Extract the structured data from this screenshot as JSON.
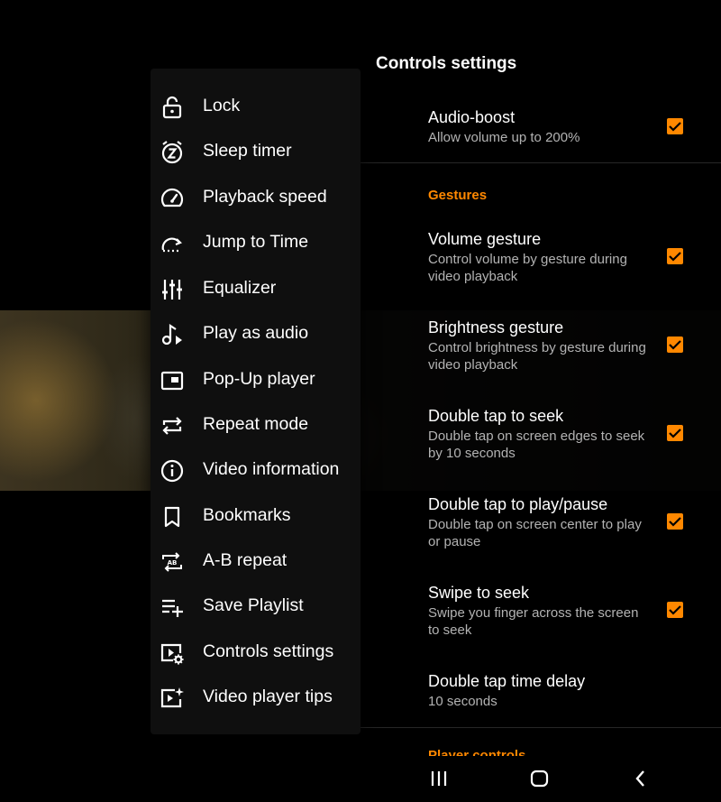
{
  "settings": {
    "title": "Controls settings",
    "audio_boost": {
      "title": "Audio-boost",
      "subtitle": "Allow volume up to 200%",
      "checked": true
    },
    "gestures_header": "Gestures",
    "volume_gesture": {
      "title": "Volume gesture",
      "subtitle": "Control volume by gesture during video playback",
      "checked": true
    },
    "brightness_gesture": {
      "title": "Brightness gesture",
      "subtitle": "Control brightness by gesture during video playback",
      "checked": true
    },
    "double_tap_seek": {
      "title": "Double tap to seek",
      "subtitle": "Double tap on screen edges to seek by 10 seconds",
      "checked": true
    },
    "double_tap_play": {
      "title": "Double tap to play/pause",
      "subtitle": "Double tap on screen center to play or pause",
      "checked": true
    },
    "swipe_seek": {
      "title": "Swipe to seek",
      "subtitle": "Swipe you finger across the screen to seek",
      "checked": true
    },
    "double_tap_delay": {
      "title": "Double tap time delay",
      "subtitle": "10 seconds"
    },
    "player_controls_header": "Player controls"
  },
  "menu": {
    "items": [
      {
        "label": "Lock",
        "icon": "lock-icon"
      },
      {
        "label": "Sleep timer",
        "icon": "sleep-timer-icon"
      },
      {
        "label": "Playback speed",
        "icon": "speedometer-icon"
      },
      {
        "label": "Jump to Time",
        "icon": "jump-to-time-icon"
      },
      {
        "label": "Equalizer",
        "icon": "equalizer-icon"
      },
      {
        "label": "Play as audio",
        "icon": "music-note-icon"
      },
      {
        "label": "Pop-Up player",
        "icon": "picture-in-picture-icon"
      },
      {
        "label": "Repeat mode",
        "icon": "repeat-icon"
      },
      {
        "label": "Video information",
        "icon": "info-icon"
      },
      {
        "label": "Bookmarks",
        "icon": "bookmark-icon"
      },
      {
        "label": "A-B repeat",
        "icon": "ab-repeat-icon"
      },
      {
        "label": "Save Playlist",
        "icon": "playlist-add-icon"
      },
      {
        "label": "Controls settings",
        "icon": "video-settings-icon"
      },
      {
        "label": "Video player tips",
        "icon": "video-tips-icon"
      }
    ]
  },
  "navbar": {
    "recents": "recents-icon",
    "home": "home-icon",
    "back": "back-icon"
  },
  "colors": {
    "accent": "#ff8800",
    "menu_bg": "#0f0f0f",
    "background": "#000000"
  }
}
